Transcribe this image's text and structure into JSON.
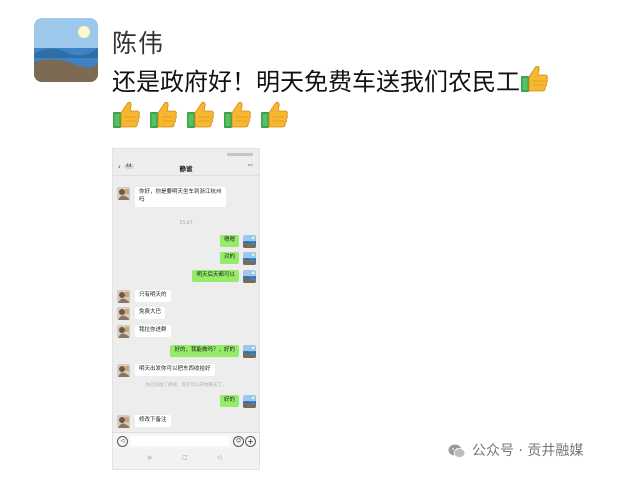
{
  "post": {
    "author": "陈伟",
    "text": "还是政府好！明天免费车送我们农民工",
    "thumbs_count": 5
  },
  "chat": {
    "back_glyph": "‹",
    "unread_badge": "44",
    "title": "静谧",
    "more_glyph": "···",
    "messages": [
      {
        "from": "contact",
        "text_lines": [
          "你好，你是要明天坐车到浙江杭州",
          "吗"
        ]
      },
      {
        "type": "time",
        "text": "15:47"
      },
      {
        "from": "me",
        "text": "嗯嗯"
      },
      {
        "from": "me",
        "text": "对的"
      },
      {
        "from": "me",
        "text": "明天后天都可以"
      },
      {
        "from": "contact",
        "text": "只有明天的"
      },
      {
        "from": "contact",
        "text": "免费大巴"
      },
      {
        "from": "contact",
        "text": "我拉你进群"
      },
      {
        "from": "me",
        "text": "好的，我能做吗？，好的"
      },
      {
        "from": "contact",
        "text": "明天出发你可以把东西收拾好"
      },
      {
        "type": "system",
        "text": "你已添加了静谧，现在可以开始聊天了。"
      },
      {
        "from": "me",
        "text": "好的"
      },
      {
        "from": "contact",
        "text": "修改下备注"
      }
    ],
    "input_bar": {
      "voice_glyph": "◁",
      "emoji_glyph": "☺",
      "plus_glyph": "+"
    },
    "nav": {
      "menu": "≡",
      "home": "□",
      "back": "◁"
    }
  },
  "watermark": {
    "text": "公众号 · 贡井融媒"
  },
  "colors": {
    "me_bubble": "#95ec69",
    "contact_bubble": "#ffffff",
    "chat_bg": "#ededed",
    "thumb": "#f5b52e",
    "cuff": "#3aa24a"
  }
}
